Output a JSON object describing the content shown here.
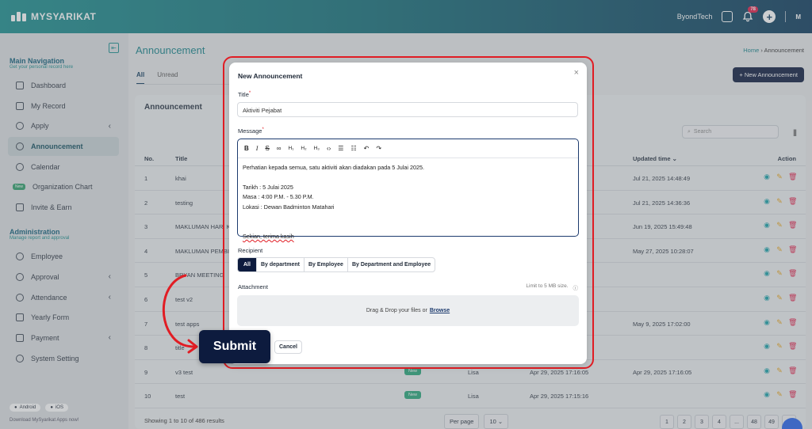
{
  "app": {
    "name": "MYSYARIKAT"
  },
  "topbar": {
    "company": "ByondTech",
    "notif_count": "78",
    "avatar": "M"
  },
  "sidebar": {
    "main_heading": "Main Navigation",
    "main_sub": "Get your personal record here",
    "main_items": [
      {
        "label": "Dashboard",
        "icon": "dashboard-icon"
      },
      {
        "label": "My Record",
        "icon": "folder-icon"
      },
      {
        "label": "Apply",
        "icon": "apply-icon",
        "chevron": true
      },
      {
        "label": "Announcement",
        "icon": "megaphone-icon",
        "active": true
      },
      {
        "label": "Calendar",
        "icon": "calendar-icon"
      },
      {
        "label": "Organization Chart",
        "icon": "org-chart-icon",
        "new": "New"
      },
      {
        "label": "Invite & Earn",
        "icon": "gift-icon"
      }
    ],
    "admin_heading": "Administration",
    "admin_sub": "Manage report and approval",
    "admin_items": [
      {
        "label": "Employee",
        "icon": "users-icon"
      },
      {
        "label": "Approval",
        "icon": "check-circle-icon",
        "chevron": true
      },
      {
        "label": "Attendance",
        "icon": "clock-icon",
        "chevron": true
      },
      {
        "label": "Yearly Form",
        "icon": "form-icon"
      },
      {
        "label": "Payment",
        "icon": "payment-icon",
        "chevron": true
      },
      {
        "label": "System Setting",
        "icon": "gear-icon"
      }
    ],
    "android": "Android",
    "ios": "iOS",
    "download_text": "Download MySyarikat Apps now!"
  },
  "page": {
    "title": "Announcement",
    "crumb_home": "Home",
    "crumb_current": "Announcement",
    "tabs": [
      "All",
      "Unread"
    ],
    "new_button": "New Announcement",
    "card_title": "Announcement",
    "search_placeholder": "Search",
    "columns": {
      "no": "No.",
      "title": "Title",
      "updated": "Updated time",
      "action": "Action"
    },
    "rows": [
      {
        "no": "1",
        "title": "khai",
        "updated": "Jul 21, 2025 14:48:49"
      },
      {
        "no": "2",
        "title": "testing",
        "updated": "Jul 21, 2025 14:36:36"
      },
      {
        "no": "3",
        "title": "MAKLUMAN HARI K",
        "updated": "Jun 19, 2025 15:49:48"
      },
      {
        "no": "4",
        "title": "MAKLUMAN PEMBI",
        "updated": "May 27, 2025 10:28:07"
      },
      {
        "no": "5",
        "title": "BRYAN MEETING",
        "updated": ""
      },
      {
        "no": "6",
        "title": "test v2",
        "updated": ""
      },
      {
        "no": "7",
        "title": "test apps",
        "updated": "May 9, 2025 17:02:00"
      },
      {
        "no": "8",
        "title": "title",
        "updated": ""
      },
      {
        "no": "9",
        "title": "v3 test",
        "tag": "New",
        "by": "Lisa",
        "created": "Apr 29, 2025 17:16:05",
        "updated": "Apr 29, 2025 17:16:05"
      },
      {
        "no": "10",
        "title": "test",
        "tag": "New",
        "by": "Lisa",
        "created": "Apr 29, 2025 17:15:16",
        "updated": ""
      }
    ],
    "showing": "Showing 1 to 10 of 486 results",
    "per_page_label": "Per page",
    "per_page_value": "10",
    "pages": [
      "1",
      "2",
      "3",
      "4",
      "...",
      "48",
      "49",
      ">"
    ]
  },
  "modal": {
    "title": "New Announcement",
    "title_label": "Title",
    "title_value": "Aktiviti Pejabat",
    "message_label": "Message",
    "toolbar": [
      "B",
      "I",
      "S",
      "link",
      "H1",
      "H2",
      "H3",
      "</>",
      "ul",
      "ol",
      "undo",
      "redo"
    ],
    "message_lines": {
      "l1": "Perhatian kepada semua, satu aktiviti akan diadakan pada 5 Julai 2025.",
      "l2": "Tarikh : 5 Julai 2025",
      "l3": "Masa : 4:00 P.M. - 5.30 P.M.",
      "l4": "Lokasi : Dewan Badminton Matahari",
      "l5": "Sekian, terima kasih"
    },
    "recipient_label": "Recipient",
    "recipient_options": [
      "All",
      "By department",
      "By Employee",
      "By Department and Employee"
    ],
    "attachment_label": "Attachment",
    "limit_text": "Limit to 5 MB size.",
    "drop_text": "Drag & Drop your files or",
    "browse": "Browse",
    "submit": "Submit",
    "cancel": "Cancel"
  }
}
